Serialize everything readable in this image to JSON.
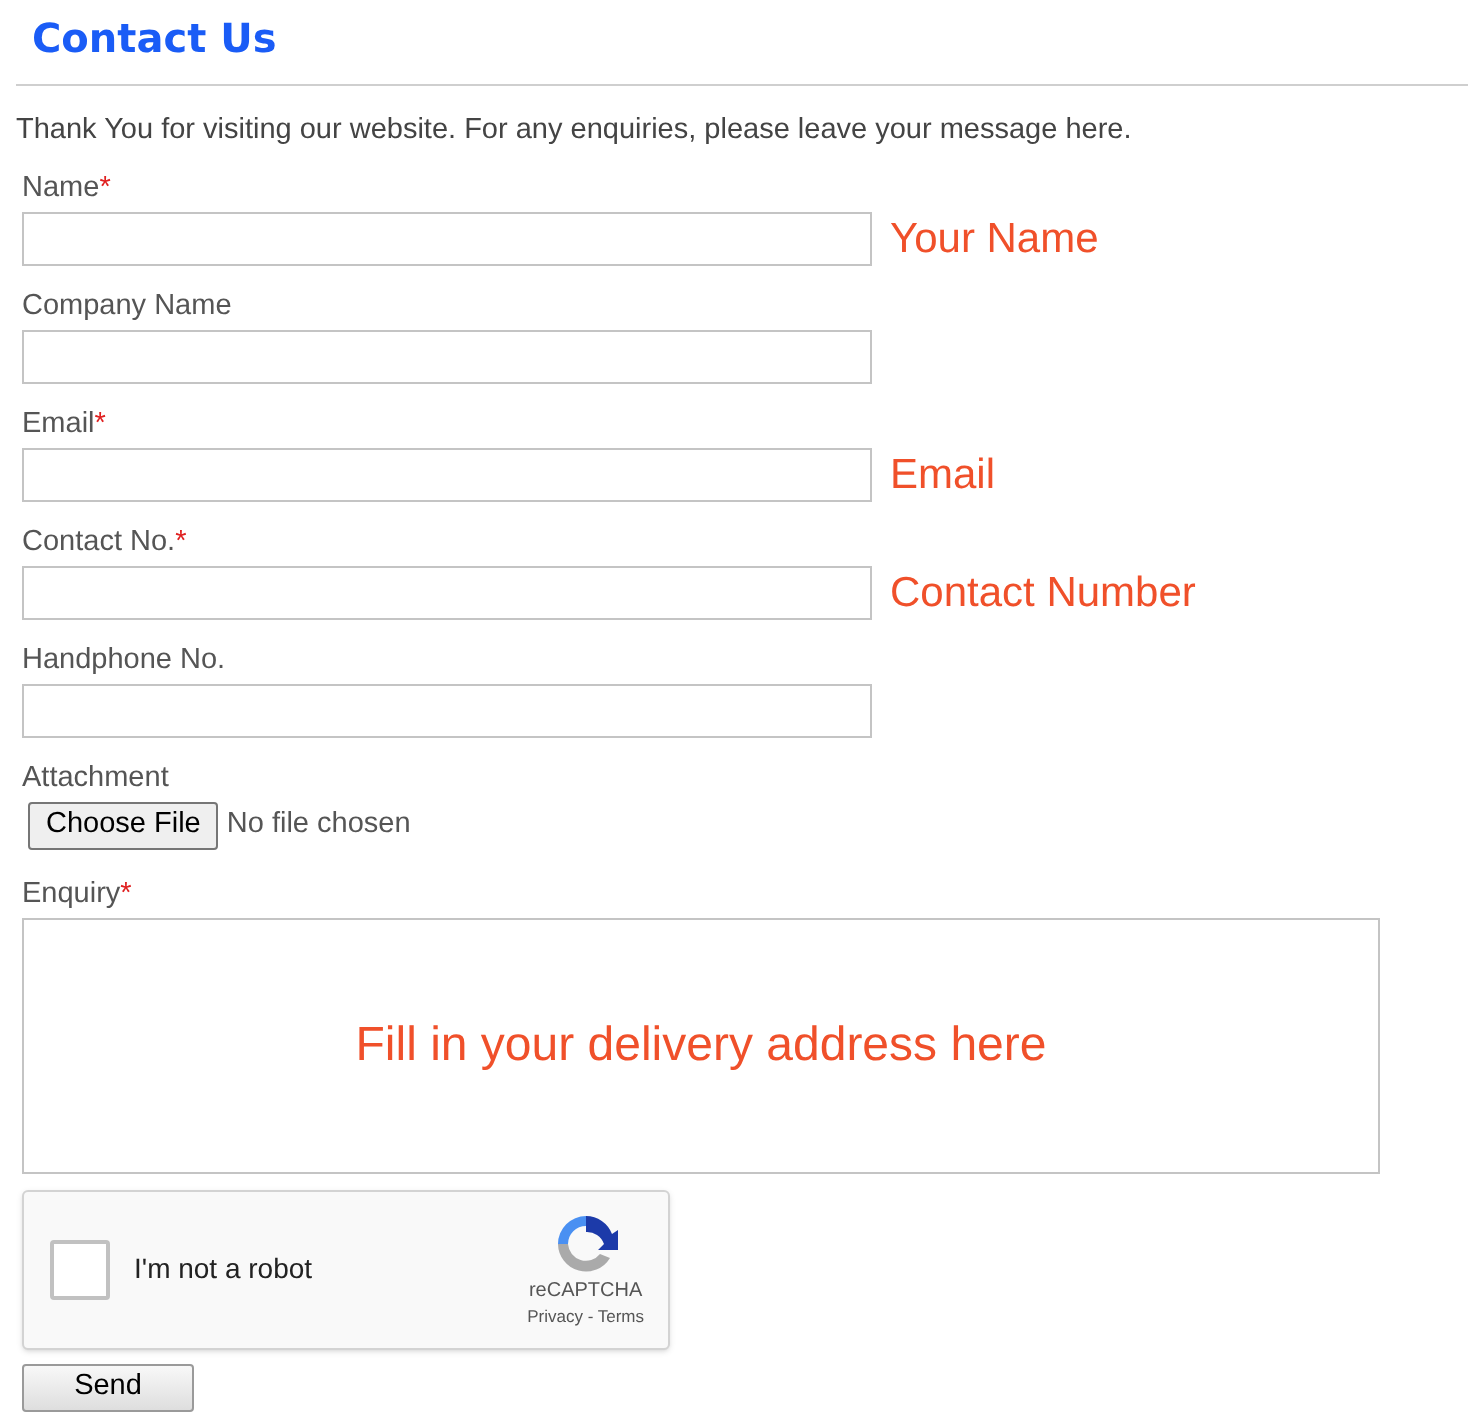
{
  "page": {
    "title": "Contact Us",
    "intro": "Thank You for visiting our website. For any enquiries, please leave your message here."
  },
  "form": {
    "required_mark": "*",
    "fields": [
      {
        "kind": "text",
        "label": "Name",
        "required": true,
        "annotation": "Your Name"
      },
      {
        "kind": "text",
        "label": "Company Name",
        "required": false
      },
      {
        "kind": "text",
        "label": "Email",
        "required": true,
        "annotation": "Email"
      },
      {
        "kind": "text",
        "label": "Contact No.",
        "required": true,
        "annotation": "Contact Number"
      },
      {
        "kind": "text",
        "label": "Handphone No.",
        "required": false
      },
      {
        "kind": "file",
        "label": "Attachment",
        "required": false,
        "button": "Choose File",
        "status": "No file chosen"
      },
      {
        "kind": "textarea",
        "label": "Enquiry",
        "required": true,
        "annotation": "Fill in your delivery address here"
      }
    ],
    "captcha": {
      "label": "I'm not a robot",
      "checked": false,
      "brand": "reCAPTCHA",
      "links": "Privacy - Terms"
    },
    "submit": "Send"
  }
}
